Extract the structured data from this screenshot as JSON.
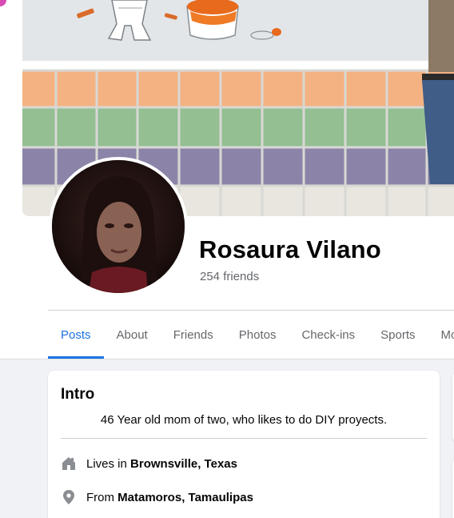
{
  "profile": {
    "name": "Rosaura Vilano",
    "friends": "254 friends"
  },
  "tabs": [
    {
      "label": "Posts",
      "active": true
    },
    {
      "label": "About",
      "active": false
    },
    {
      "label": "Friends",
      "active": false
    },
    {
      "label": "Photos",
      "active": false
    },
    {
      "label": "Check-ins",
      "active": false
    },
    {
      "label": "Sports",
      "active": false
    },
    {
      "label": "Mo",
      "active": false
    }
  ],
  "intro": {
    "title": "Intro",
    "bio": "46 Year old mom of two, who likes to do DIY proyects.",
    "lives_prefix": "Lives in",
    "lives_value": "Brownsville, Texas",
    "from_prefix": "From",
    "from_value": "Matamoros, Tamaulipas"
  },
  "icons": {
    "lives": "home-icon",
    "from": "location-pin-icon"
  },
  "colors": {
    "accent": "#1b74e4",
    "secondary_text": "#65676b",
    "background": "#f0f2f5"
  }
}
